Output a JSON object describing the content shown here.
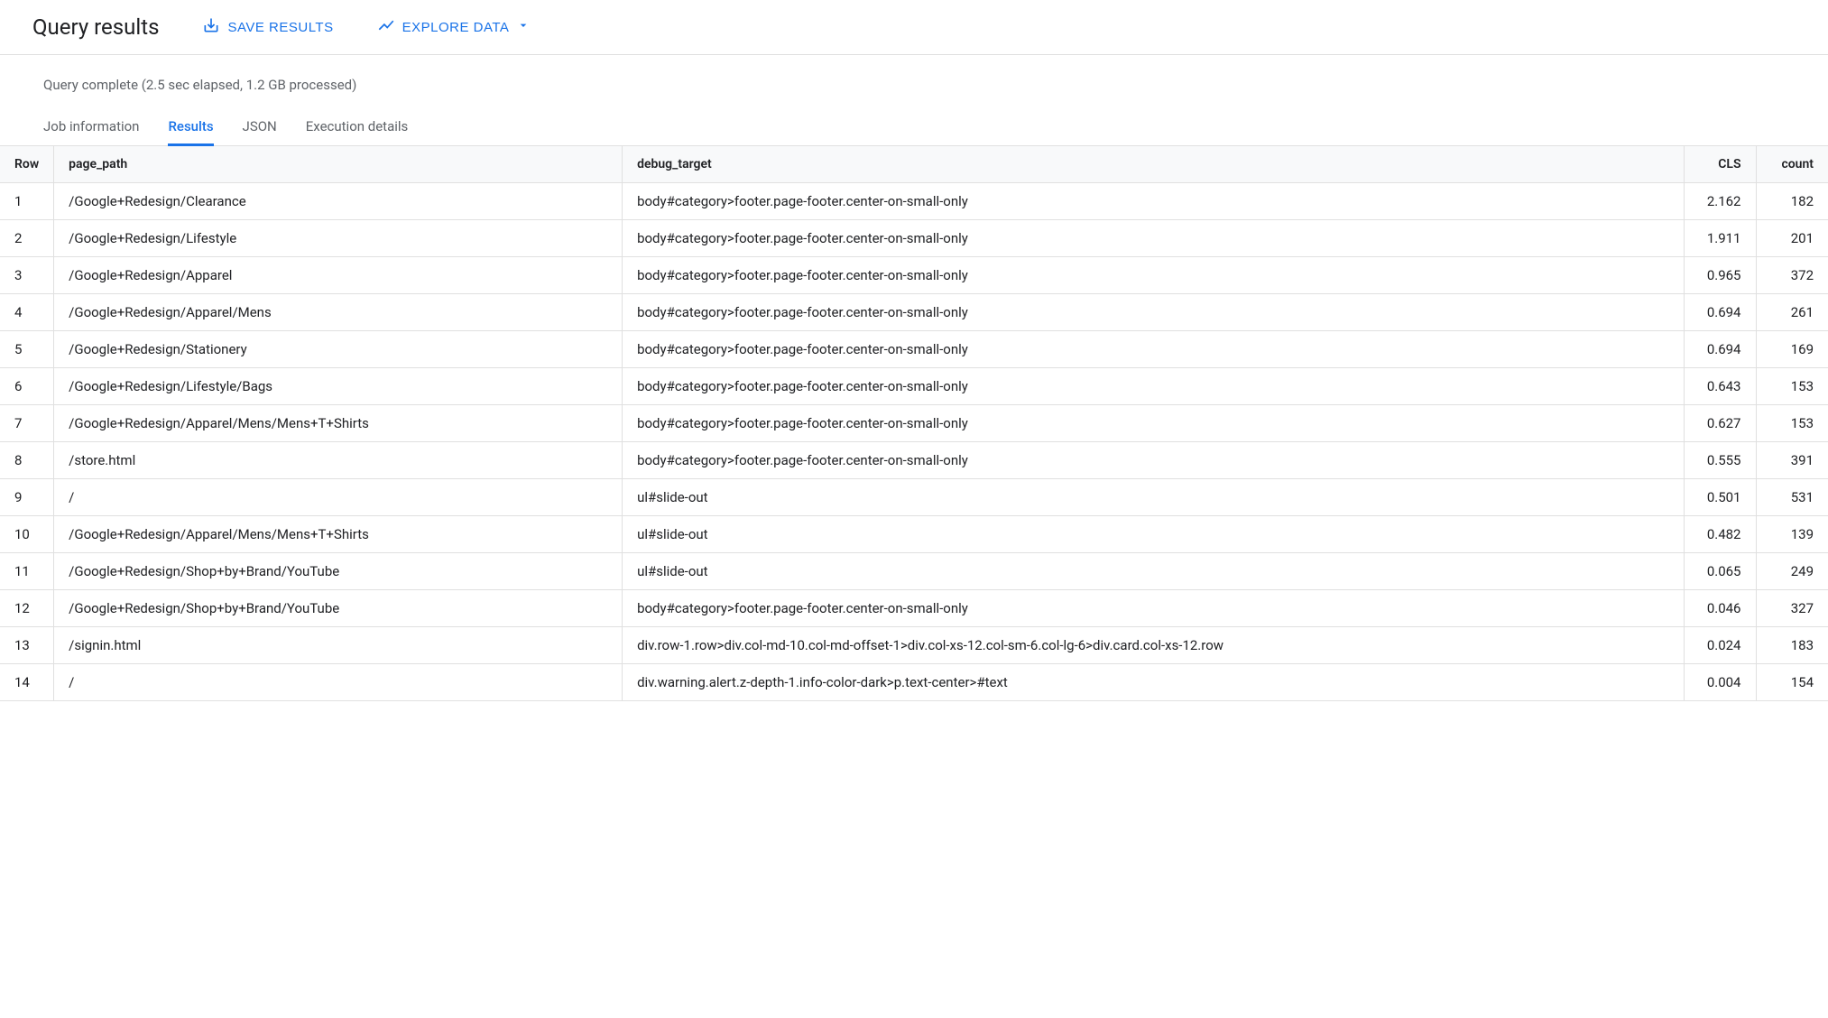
{
  "header": {
    "title": "Query results",
    "save_results_label": "SAVE RESULTS",
    "explore_data_label": "EXPLORE DATA"
  },
  "status": "Query complete (2.5 sec elapsed, 1.2 GB processed)",
  "tabs": [
    {
      "label": "Job information",
      "active": false
    },
    {
      "label": "Results",
      "active": true
    },
    {
      "label": "JSON",
      "active": false
    },
    {
      "label": "Execution details",
      "active": false
    }
  ],
  "table": {
    "headers": [
      "Row",
      "page_path",
      "debug_target",
      "CLS",
      "count"
    ],
    "rows": [
      {
        "row": "1",
        "page_path": "/Google+Redesign/Clearance",
        "debug_target": "body#category>footer.page-footer.center-on-small-only",
        "cls": "2.162",
        "count": "182"
      },
      {
        "row": "2",
        "page_path": "/Google+Redesign/Lifestyle",
        "debug_target": "body#category>footer.page-footer.center-on-small-only",
        "cls": "1.911",
        "count": "201"
      },
      {
        "row": "3",
        "page_path": "/Google+Redesign/Apparel",
        "debug_target": "body#category>footer.page-footer.center-on-small-only",
        "cls": "0.965",
        "count": "372"
      },
      {
        "row": "4",
        "page_path": "/Google+Redesign/Apparel/Mens",
        "debug_target": "body#category>footer.page-footer.center-on-small-only",
        "cls": "0.694",
        "count": "261"
      },
      {
        "row": "5",
        "page_path": "/Google+Redesign/Stationery",
        "debug_target": "body#category>footer.page-footer.center-on-small-only",
        "cls": "0.694",
        "count": "169"
      },
      {
        "row": "6",
        "page_path": "/Google+Redesign/Lifestyle/Bags",
        "debug_target": "body#category>footer.page-footer.center-on-small-only",
        "cls": "0.643",
        "count": "153"
      },
      {
        "row": "7",
        "page_path": "/Google+Redesign/Apparel/Mens/Mens+T+Shirts",
        "debug_target": "body#category>footer.page-footer.center-on-small-only",
        "cls": "0.627",
        "count": "153"
      },
      {
        "row": "8",
        "page_path": "/store.html",
        "debug_target": "body#category>footer.page-footer.center-on-small-only",
        "cls": "0.555",
        "count": "391"
      },
      {
        "row": "9",
        "page_path": "/",
        "debug_target": "ul#slide-out",
        "cls": "0.501",
        "count": "531"
      },
      {
        "row": "10",
        "page_path": "/Google+Redesign/Apparel/Mens/Mens+T+Shirts",
        "debug_target": "ul#slide-out",
        "cls": "0.482",
        "count": "139"
      },
      {
        "row": "11",
        "page_path": "/Google+Redesign/Shop+by+Brand/YouTube",
        "debug_target": "ul#slide-out",
        "cls": "0.065",
        "count": "249"
      },
      {
        "row": "12",
        "page_path": "/Google+Redesign/Shop+by+Brand/YouTube",
        "debug_target": "body#category>footer.page-footer.center-on-small-only",
        "cls": "0.046",
        "count": "327"
      },
      {
        "row": "13",
        "page_path": "/signin.html",
        "debug_target": "div.row-1.row>div.col-md-10.col-md-offset-1>div.col-xs-12.col-sm-6.col-lg-6>div.card.col-xs-12.row",
        "cls": "0.024",
        "count": "183"
      },
      {
        "row": "14",
        "page_path": "/",
        "debug_target": "div.warning.alert.z-depth-1.info-color-dark>p.text-center>#text",
        "cls": "0.004",
        "count": "154"
      }
    ]
  }
}
